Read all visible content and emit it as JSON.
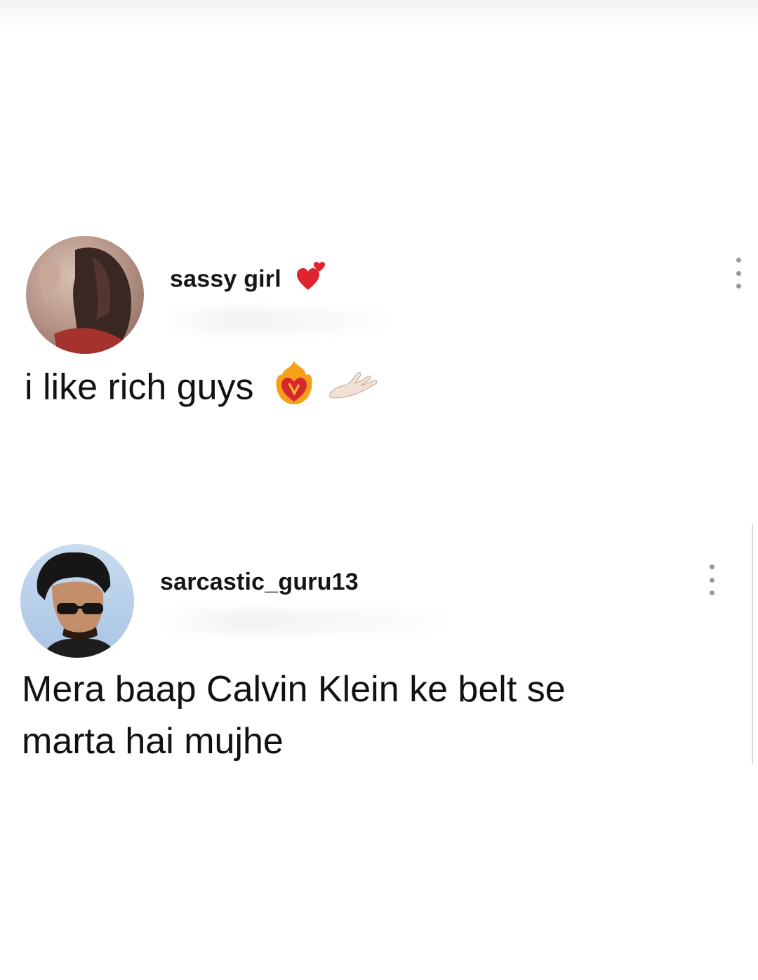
{
  "posts": [
    {
      "username": "sassy girl",
      "badge_icon": "revolving-hearts-emoji",
      "text": "i like rich guys",
      "text_emojis": [
        "heart-on-fire-emoji",
        "palm-up-hand-emoji"
      ],
      "menu_icon": "vertical-ellipsis-icon"
    },
    {
      "username": "sarcastic_guru13",
      "text_line1": "Mera baap Calvin Klein ke belt se",
      "text_line2": "marta hai mujhe",
      "menu_icon": "vertical-ellipsis-icon"
    }
  ],
  "colors": {
    "background": "#ffffff",
    "text": "#111111",
    "menu_dots": "#9a9a9a"
  }
}
